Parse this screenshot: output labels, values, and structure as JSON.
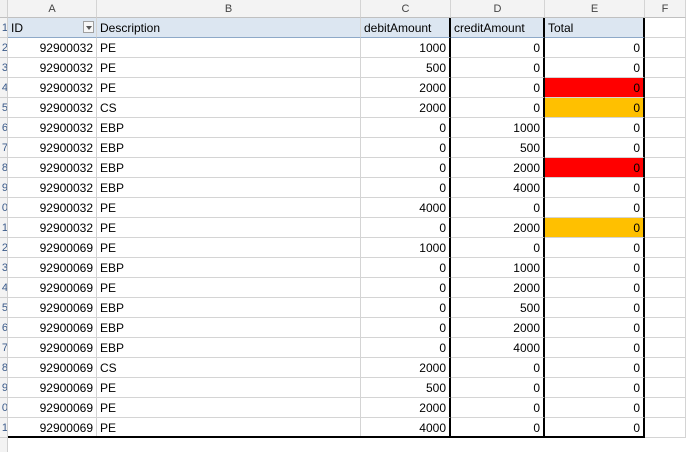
{
  "columns": [
    "A",
    "B",
    "C",
    "D",
    "E",
    "F"
  ],
  "headers": {
    "id": "ID",
    "description": "Description",
    "debit": "debitAmount",
    "credit": "creditAmount",
    "total": "Total"
  },
  "row_numbers": [
    "1",
    "2",
    "3",
    "4",
    "5",
    "6",
    "7",
    "8",
    "9",
    "0",
    "1",
    "2",
    "3",
    "4",
    "5",
    "6",
    "7",
    "8",
    "9",
    "0",
    "1"
  ],
  "colors": {
    "red": "#ff0000",
    "orange": "#ffc000",
    "header_fill": "#dce6f1"
  },
  "rows": [
    {
      "id": "92900032",
      "desc": "PE",
      "debit": "1000",
      "credit": "0",
      "total": "0",
      "hl": ""
    },
    {
      "id": "92900032",
      "desc": "PE",
      "debit": "500",
      "credit": "0",
      "total": "0",
      "hl": ""
    },
    {
      "id": "92900032",
      "desc": "PE",
      "debit": "2000",
      "credit": "0",
      "total": "0",
      "hl": "red"
    },
    {
      "id": "92900032",
      "desc": "CS",
      "debit": "2000",
      "credit": "0",
      "total": "0",
      "hl": "orange"
    },
    {
      "id": "92900032",
      "desc": "EBP",
      "debit": "0",
      "credit": "1000",
      "total": "0",
      "hl": ""
    },
    {
      "id": "92900032",
      "desc": "EBP",
      "debit": "0",
      "credit": "500",
      "total": "0",
      "hl": ""
    },
    {
      "id": "92900032",
      "desc": "EBP",
      "debit": "0",
      "credit": "2000",
      "total": "0",
      "hl": "red"
    },
    {
      "id": "92900032",
      "desc": "EBP",
      "debit": "0",
      "credit": "4000",
      "total": "0",
      "hl": ""
    },
    {
      "id": "92900032",
      "desc": "PE",
      "debit": "4000",
      "credit": "0",
      "total": "0",
      "hl": ""
    },
    {
      "id": "92900032",
      "desc": "PE",
      "debit": "0",
      "credit": "2000",
      "total": "0",
      "hl": "orange"
    },
    {
      "id": "92900069",
      "desc": "PE",
      "debit": "1000",
      "credit": "0",
      "total": "0",
      "hl": ""
    },
    {
      "id": "92900069",
      "desc": "EBP",
      "debit": "0",
      "credit": "1000",
      "total": "0",
      "hl": ""
    },
    {
      "id": "92900069",
      "desc": "PE",
      "debit": "0",
      "credit": "2000",
      "total": "0",
      "hl": ""
    },
    {
      "id": "92900069",
      "desc": "EBP",
      "debit": "0",
      "credit": "500",
      "total": "0",
      "hl": ""
    },
    {
      "id": "92900069",
      "desc": "EBP",
      "debit": "0",
      "credit": "2000",
      "total": "0",
      "hl": ""
    },
    {
      "id": "92900069",
      "desc": "EBP",
      "debit": "0",
      "credit": "4000",
      "total": "0",
      "hl": ""
    },
    {
      "id": "92900069",
      "desc": "CS",
      "debit": "2000",
      "credit": "0",
      "total": "0",
      "hl": ""
    },
    {
      "id": "92900069",
      "desc": "PE",
      "debit": "500",
      "credit": "0",
      "total": "0",
      "hl": ""
    },
    {
      "id": "92900069",
      "desc": "PE",
      "debit": "2000",
      "credit": "0",
      "total": "0",
      "hl": ""
    },
    {
      "id": "92900069",
      "desc": "PE",
      "debit": "4000",
      "credit": "0",
      "total": "0",
      "hl": ""
    }
  ]
}
